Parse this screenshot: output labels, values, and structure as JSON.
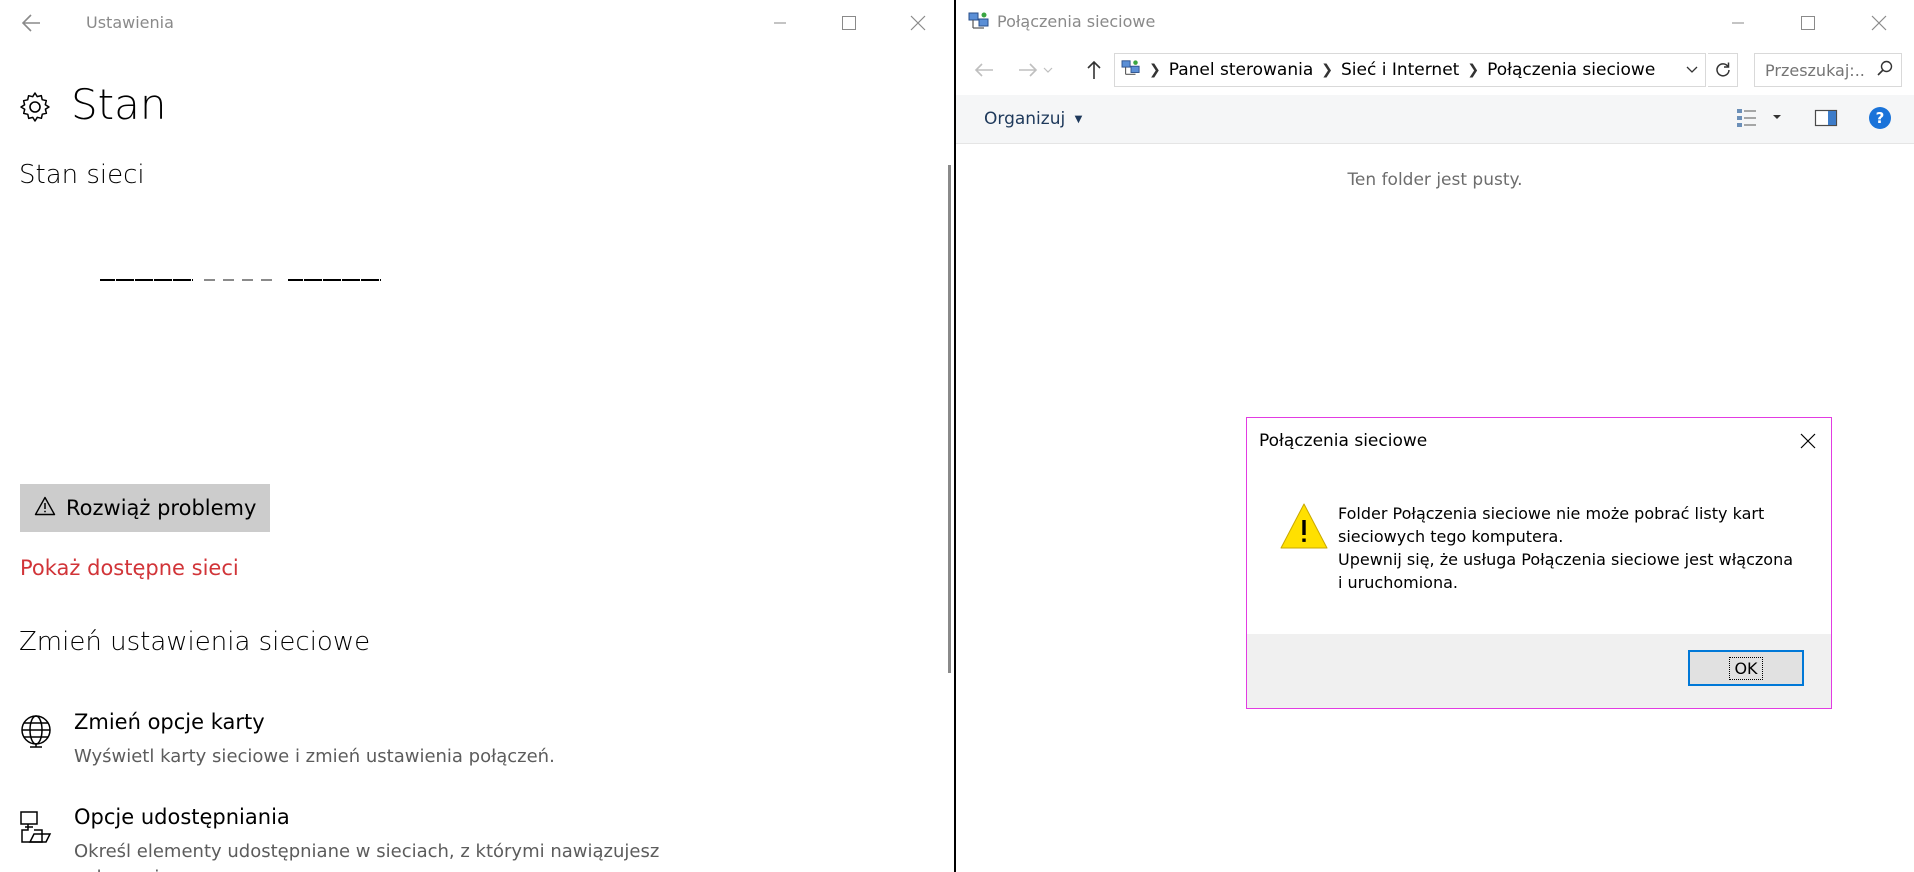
{
  "settings": {
    "window_title": "Ustawienia",
    "page_title": "Stan",
    "network_status_heading": "Stan sieci",
    "troubleshoot_label": "Rozwiąż problemy",
    "show_networks_link": "Pokaż dostępne sieci",
    "change_settings_heading": "Zmień ustawienia sieciowe",
    "options": [
      {
        "title": "Zmień opcje karty",
        "description": "Wyświetl karty sieciowe i zmień ustawienia połączeń.",
        "icon": "globe-icon"
      },
      {
        "title": "Opcje udostępniania",
        "description": "Określ elementy udostępniane w sieciach, z którymi nawiązujesz połączenie.",
        "icon": "sharing-icon"
      }
    ],
    "link_color": "#d13438"
  },
  "explorer": {
    "window_title": "Połączenia sieciowe",
    "breadcrumb": [
      "Panel sterowania",
      "Sieć i Internet",
      "Połączenia sieciowe"
    ],
    "search_placeholder": "Przeszukaj:...",
    "organize_label": "Organizuj",
    "empty_message": "Ten folder jest pusty."
  },
  "dialog": {
    "title": "Połączenia sieciowe",
    "message_line1": "Folder Połączenia sieciowe nie może pobrać listy kart sieciowych tego komputera.",
    "message_line2": "Upewnij się, że usługa Połączenia sieciowe jest włączona i uruchomiona.",
    "ok_label": "OK",
    "border_color": "#e23be2",
    "focus_color": "#0078d7"
  }
}
